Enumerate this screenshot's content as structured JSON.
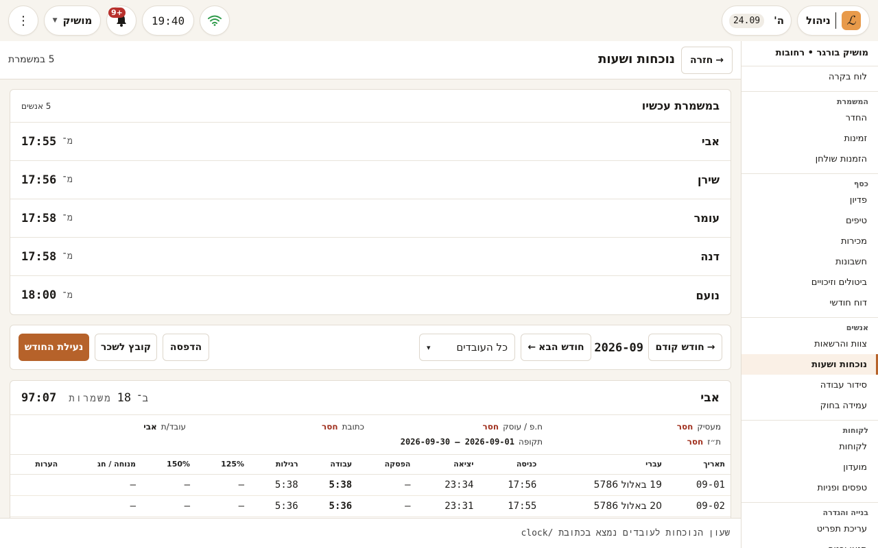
{
  "topbar": {
    "brand_name": "ניהול",
    "logo_glyph": "ℒ",
    "day_letter": "ה'",
    "date": "24.09",
    "time": "19:40",
    "notifications_badge": "+9",
    "user_name": "מושיק",
    "more_glyph": "⋮"
  },
  "sidebar": {
    "venue": "מושיק בורגר • רחובות",
    "top_items": [
      "לוח בקרה"
    ],
    "sections": [
      {
        "title": "המשמרת",
        "items": [
          "החדר",
          "זמינות",
          "הזמנות שולחן"
        ]
      },
      {
        "title": "כסף",
        "items": [
          "פדיון",
          "טיפים",
          "מכירות",
          "חשבונות",
          "ביטולים וזיכויים",
          "דוח חודשי"
        ]
      },
      {
        "title": "אנשים",
        "items": [
          "צוות והרשאות",
          "נוכחות ושעות",
          "סידור עבודה",
          "עמידה בחוק"
        ]
      },
      {
        "title": "לקוחות",
        "items": [
          "לקוחות",
          "מועדון",
          "טפסים ופניות"
        ]
      },
      {
        "title": "בנייה והגדרה",
        "items": [
          "עריכת תפריט",
          "תנאי וכנופ"
        ]
      }
    ],
    "active": "נוכחות ושעות"
  },
  "header": {
    "back_label": "חזרה",
    "back_arrow": "→",
    "title": "נוכחות ושעות",
    "shift_count": "5 במשמרת"
  },
  "now": {
    "title": "במשמרת עכשיו",
    "count": "5 אנשים",
    "from_label": "מ־",
    "employees": [
      {
        "name": "אבי",
        "time": "17:55"
      },
      {
        "name": "שירן",
        "time": "17:56"
      },
      {
        "name": "עומר",
        "time": "17:58"
      },
      {
        "name": "דנה",
        "time": "17:58"
      },
      {
        "name": "נועם",
        "time": "18:00"
      }
    ]
  },
  "toolbar": {
    "prev_label": "חודש קודם",
    "prev_arrow": "→",
    "month": "2026-09",
    "next_label": "חודש הבא",
    "next_arrow": "←",
    "employee_filter": "כל העובדים",
    "print_label": "הדפסה",
    "payroll_label": "קובץ לשכר",
    "lock_label": "נעילת החודש"
  },
  "report": {
    "name": "אבי",
    "shifts_prefix": "ב־",
    "shifts_num": "18",
    "shifts_word": "משמרות",
    "total": "97:07",
    "meta": {
      "employer_k": "מעסיק",
      "employer_v": "חסר",
      "tax_k": "ח.פ / עוסק",
      "tax_v": "חסר",
      "address_k": "כתובת",
      "address_v": "חסר",
      "worker_k": "עובד/ת",
      "worker_v": "אבי",
      "id_k": "ת״ז",
      "id_v": "חסר",
      "period_k": "תקופה",
      "period_v": "2026-09-01 – 2026-09-30"
    },
    "columns": [
      "תאריך",
      "עברי",
      "כניסה",
      "יציאה",
      "הפסקה",
      "עבודה",
      "רגילות",
      "125%",
      "150%",
      "מנוחה / חג",
      "הערות"
    ],
    "rows": [
      [
        "09-01",
        "19 באלול 5786",
        "17:56",
        "23:34",
        "–",
        "5:38",
        "5:38",
        "–",
        "–",
        "–",
        ""
      ],
      [
        "09-02",
        "20 באלול 5786",
        "17:55",
        "23:31",
        "–",
        "5:36",
        "5:36",
        "–",
        "–",
        "–",
        ""
      ]
    ]
  },
  "footer": {
    "note": "שעון הנוכחות לעובדים נמצא בכתובת /clock"
  }
}
